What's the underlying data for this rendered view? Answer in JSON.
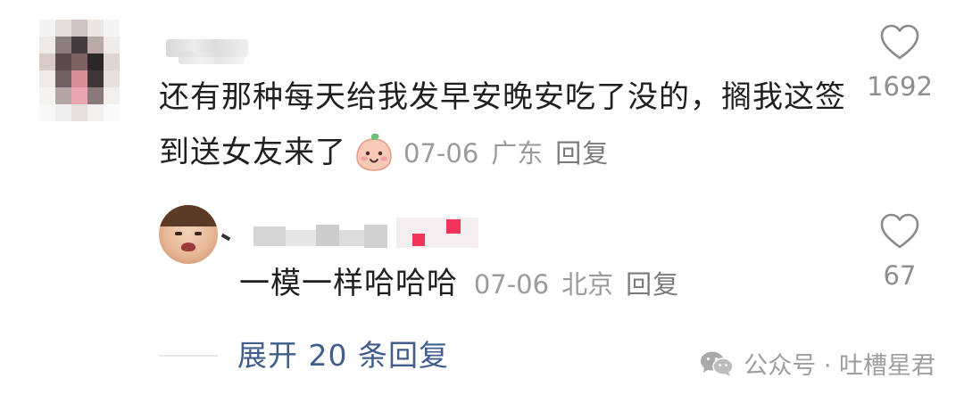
{
  "main_comment": {
    "text": "还有那种每天给我发早安晚安吃了没的，搁我这签到送女友来了",
    "date": "07-06",
    "location": "广东",
    "reply_label": "回复",
    "likes": "1692",
    "emoji_icon": "peach-face-emoji"
  },
  "reply_comment": {
    "text": "一模一样哈哈哈",
    "date": "07-06",
    "location": "北京",
    "reply_label": "回复",
    "likes": "67"
  },
  "expand_label": "展开 20 条回复",
  "watermark": {
    "text": "公众号 · 吐槽星君",
    "icon": "wechat-icon"
  },
  "colors": {
    "text": "#1f1f1f",
    "meta": "#9b9b9b",
    "link": "#3f5e8c",
    "accent_pink": "#f2345a"
  }
}
